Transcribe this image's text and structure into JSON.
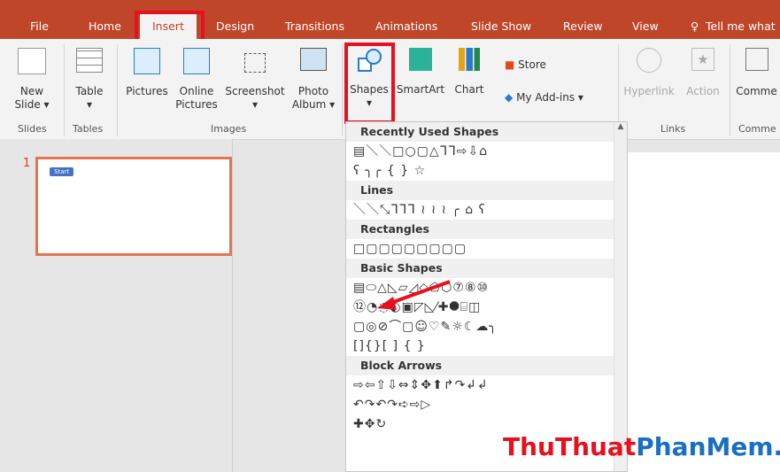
{
  "tabs": [
    "File",
    "Home",
    "Insert",
    "Design",
    "Transitions",
    "Animations",
    "Slide Show",
    "Review",
    "View"
  ],
  "tell_me": "Tell me what",
  "ribbon": {
    "new_slide": "New",
    "new_slide2": "Slide ▾",
    "table": "Table",
    "table2": "▾",
    "pictures": "Pictures",
    "online": "Online",
    "online2": "Pictures",
    "screenshot": "Screenshot",
    "screenshot2": "▾",
    "album": "Photo",
    "album2": "Album ▾",
    "shapes": "Shapes",
    "shapes2": "▾",
    "smartart": "SmartArt",
    "chart": "Chart",
    "store": "Store",
    "addins": "My Add-ins",
    "addins_arrow": "▾",
    "hyperlink": "Hyperlink",
    "action": "Action",
    "comment": "Comme",
    "groups": [
      "Slides",
      "Tables",
      "Images",
      "Links",
      "Comme"
    ]
  },
  "thumb": {
    "number": "1",
    "label": "Start"
  },
  "gallery": {
    "sections": [
      "Recently Used Shapes",
      "Lines",
      "Rectangles",
      "Basic Shapes",
      "Block Arrows"
    ],
    "recent1": "▤＼＼□○▢△ᒣᒣ⇨⇩⌂",
    "recent2": "ʕ ╮╭ { } ☆",
    "lines": "＼＼⤡ᒣᒣᒣ ≀ ≀ ≀ ╭ ⌂ ʕ",
    "rects": "□▢▢▢▢▢▢▢▢",
    "basic1": "▤⬭△◺▱◿◇⬠⬡⑦⑧⑩",
    "basic2": "⑫◔◌◐▣◸◺⁄✚⯃⌸◫",
    "basic3": "▢◎⊘⌒▢☺♡✎☼☾☁╮",
    "basic4": "[]{}[ ] { }",
    "arrows1": "⇨⇦⇧⇩⇔⇕✥⬆↱↷↲↲",
    "arrows2": "↶↷↶↷➪⇨▷",
    "arrows3": "✚✥↻"
  },
  "watermark": {
    "part1": "ThuThuat",
    "part2": "PhanMem",
    ".vn": ".vn"
  },
  "colors": {
    "accent": "#c0462a",
    "highlight": "#e8101f"
  }
}
